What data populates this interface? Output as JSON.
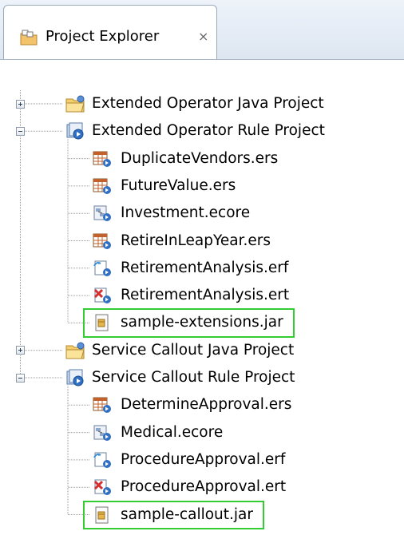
{
  "view": {
    "title": "Project Explorer",
    "close_glyph": "⨯"
  },
  "tree": [
    {
      "label": "Extended Operator Java Project",
      "icon": "java-project-icon",
      "level": 0,
      "expander": "collapsed"
    },
    {
      "label": "Extended Operator Rule Project",
      "icon": "rule-project-icon",
      "level": 0,
      "expander": "expanded"
    },
    {
      "label": "DuplicateVendors.ers",
      "icon": "ers-file-icon",
      "level": 1
    },
    {
      "label": "FutureValue.ers",
      "icon": "ers-file-icon",
      "level": 1
    },
    {
      "label": "Investment.ecore",
      "icon": "ecore-file-icon",
      "level": 1
    },
    {
      "label": "RetireInLeapYear.ers",
      "icon": "ers-file-icon",
      "level": 1
    },
    {
      "label": "RetirementAnalysis.erf",
      "icon": "erf-file-icon",
      "level": 1
    },
    {
      "label": "RetirementAnalysis.ert",
      "icon": "ert-file-icon",
      "level": 1
    },
    {
      "label": "sample-extensions.jar",
      "icon": "jar-file-icon",
      "level": 1,
      "highlight": true
    },
    {
      "label": "Service Callout Java Project",
      "icon": "java-project-icon",
      "level": 0,
      "expander": "collapsed"
    },
    {
      "label": "Service Callout Rule Project",
      "icon": "rule-project-icon",
      "level": 0,
      "expander": "expanded"
    },
    {
      "label": "DetermineApproval.ers",
      "icon": "ers-file-icon",
      "level": 1
    },
    {
      "label": "Medical.ecore",
      "icon": "ecore-file-icon",
      "level": 1
    },
    {
      "label": "ProcedureApproval.erf",
      "icon": "erf-file-icon",
      "level": 1
    },
    {
      "label": "ProcedureApproval.ert",
      "icon": "ert-file-icon",
      "level": 1
    },
    {
      "label": "sample-callout.jar",
      "icon": "jar-file-icon",
      "level": 1,
      "highlight": true
    }
  ],
  "colors": {
    "highlight": "#33cc33",
    "tree_line": "#9a9a9a"
  }
}
